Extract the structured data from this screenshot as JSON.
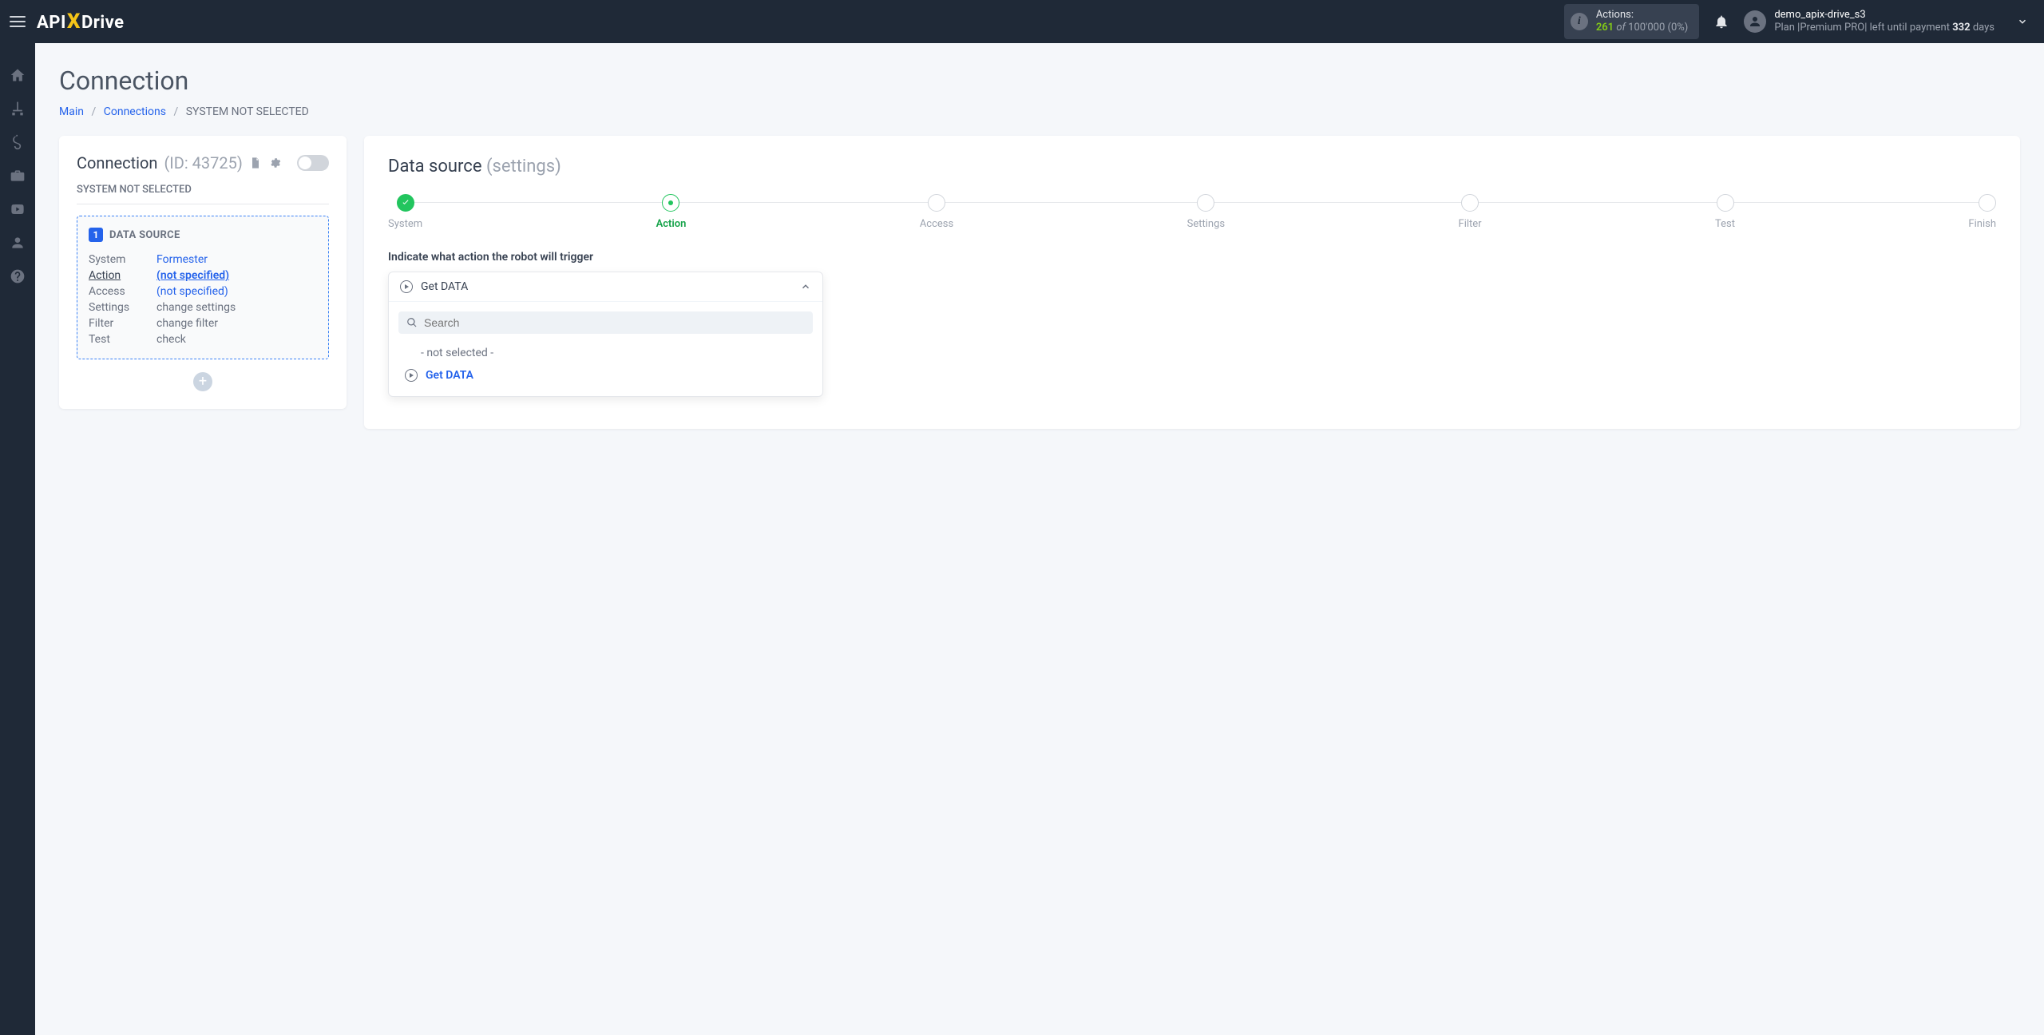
{
  "header": {
    "logo_api": "API",
    "logo_x": "X",
    "logo_drive": "Drive",
    "actions_label": "Actions:",
    "actions_used": "261",
    "actions_of": "of",
    "actions_total": "100'000",
    "actions_pct": "(0%)",
    "username": "demo_apix-drive_s3",
    "plan_prefix": "Plan |",
    "plan_name": "Premium PRO",
    "plan_suffix": "| left until payment",
    "plan_days": "332",
    "plan_days_label": "days"
  },
  "page": {
    "title": "Connection",
    "crumb_main": "Main",
    "crumb_connections": "Connections",
    "crumb_current": "SYSTEM NOT SELECTED"
  },
  "left": {
    "title": "Connection",
    "id_label": "(ID: 43725)",
    "subtitle": "SYSTEM NOT SELECTED",
    "ds_num": "1",
    "ds_title": "DATA SOURCE",
    "rows": {
      "system_k": "System",
      "system_v": "Formester",
      "action_k": "Action",
      "action_v": "(not specified)",
      "access_k": "Access",
      "access_v": "(not specified)",
      "settings_k": "Settings",
      "settings_v": "change settings",
      "filter_k": "Filter",
      "filter_v": "change filter",
      "test_k": "Test",
      "test_v": "check"
    }
  },
  "right": {
    "title": "Data source",
    "title_sub": "(settings)",
    "steps": {
      "system": "System",
      "action": "Action",
      "access": "Access",
      "settings": "Settings",
      "filter": "Filter",
      "test": "Test",
      "finish": "Finish"
    },
    "field_label": "Indicate what action the robot will trigger",
    "selected": "Get DATA",
    "search_placeholder": "Search",
    "opt_not_selected": "- not selected -",
    "opt_get_data": "Get DATA"
  }
}
